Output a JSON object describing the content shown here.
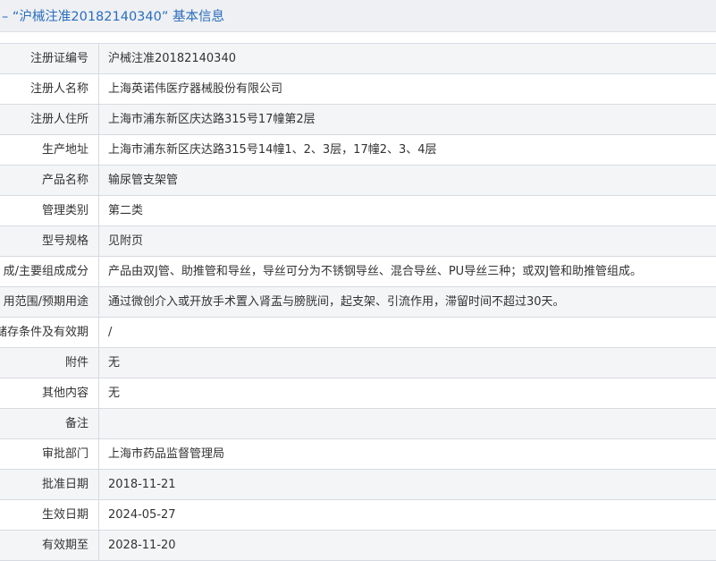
{
  "header": {
    "title": "– “沪械注准20182140340” 基本信息"
  },
  "rows": [
    {
      "label": "注册证编号",
      "value": "沪械注准20182140340"
    },
    {
      "label": "注册人名称",
      "value": "上海英诺伟医疗器械股份有限公司"
    },
    {
      "label": "注册人住所",
      "value": "上海市浦东新区庆达路315号17幢第2层"
    },
    {
      "label": "生产地址",
      "value": "上海市浦东新区庆达路315号14幢1、2、3层，17幢2、3、4层"
    },
    {
      "label": "产品名称",
      "value": "输尿管支架管"
    },
    {
      "label": "管理类别",
      "value": "第二类"
    },
    {
      "label": "型号规格",
      "value": "见附页"
    },
    {
      "label": "成/主要组成成分",
      "value": "产品由双J管、助推管和导丝，导丝可分为不锈钢导丝、混合导丝、PU导丝三种；或双J管和助推管组成。"
    },
    {
      "label": "用范围/预期用途",
      "value": "通过微创介入或开放手术置入肾盂与膀胱间，起支架、引流作用，滞留时间不超过30天。"
    },
    {
      "label": "储存条件及有效期",
      "value": "/"
    },
    {
      "label": "附件",
      "value": "无"
    },
    {
      "label": "其他内容",
      "value": "无"
    },
    {
      "label": "备注",
      "value": ""
    },
    {
      "label": "审批部门",
      "value": "上海市药品监督管理局"
    },
    {
      "label": "批准日期",
      "value": "2018-11-21"
    },
    {
      "label": "生效日期",
      "value": "2024-05-27"
    },
    {
      "label": "有效期至",
      "value": "2028-11-20"
    }
  ]
}
